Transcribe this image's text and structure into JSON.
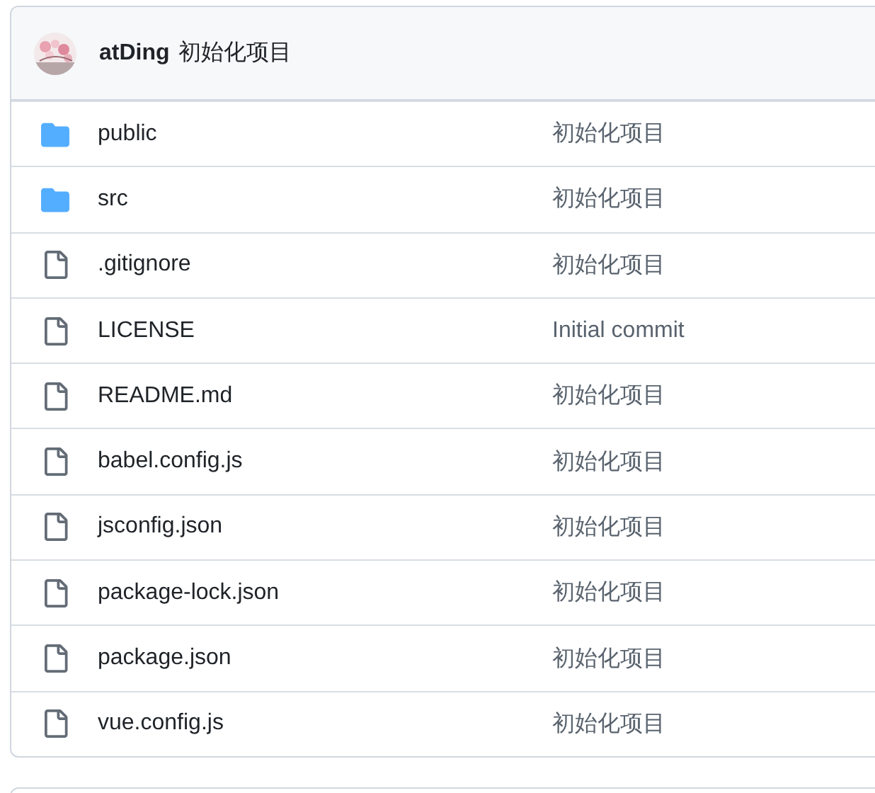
{
  "commit_header": {
    "author": "atDing",
    "message": "初始化项目"
  },
  "files": [
    {
      "kind": "dir",
      "name": "public",
      "message": "初始化项目"
    },
    {
      "kind": "dir",
      "name": "src",
      "message": "初始化项目"
    },
    {
      "kind": "file",
      "name": ".gitignore",
      "message": "初始化项目"
    },
    {
      "kind": "file",
      "name": "LICENSE",
      "message": "Initial commit"
    },
    {
      "kind": "file",
      "name": "README.md",
      "message": "初始化项目"
    },
    {
      "kind": "file",
      "name": "babel.config.js",
      "message": "初始化项目"
    },
    {
      "kind": "file",
      "name": "jsconfig.json",
      "message": "初始化项目"
    },
    {
      "kind": "file",
      "name": "package-lock.json",
      "message": "初始化项目"
    },
    {
      "kind": "file",
      "name": "package.json",
      "message": "初始化项目"
    },
    {
      "kind": "file",
      "name": "vue.config.js",
      "message": "初始化项目"
    }
  ]
}
